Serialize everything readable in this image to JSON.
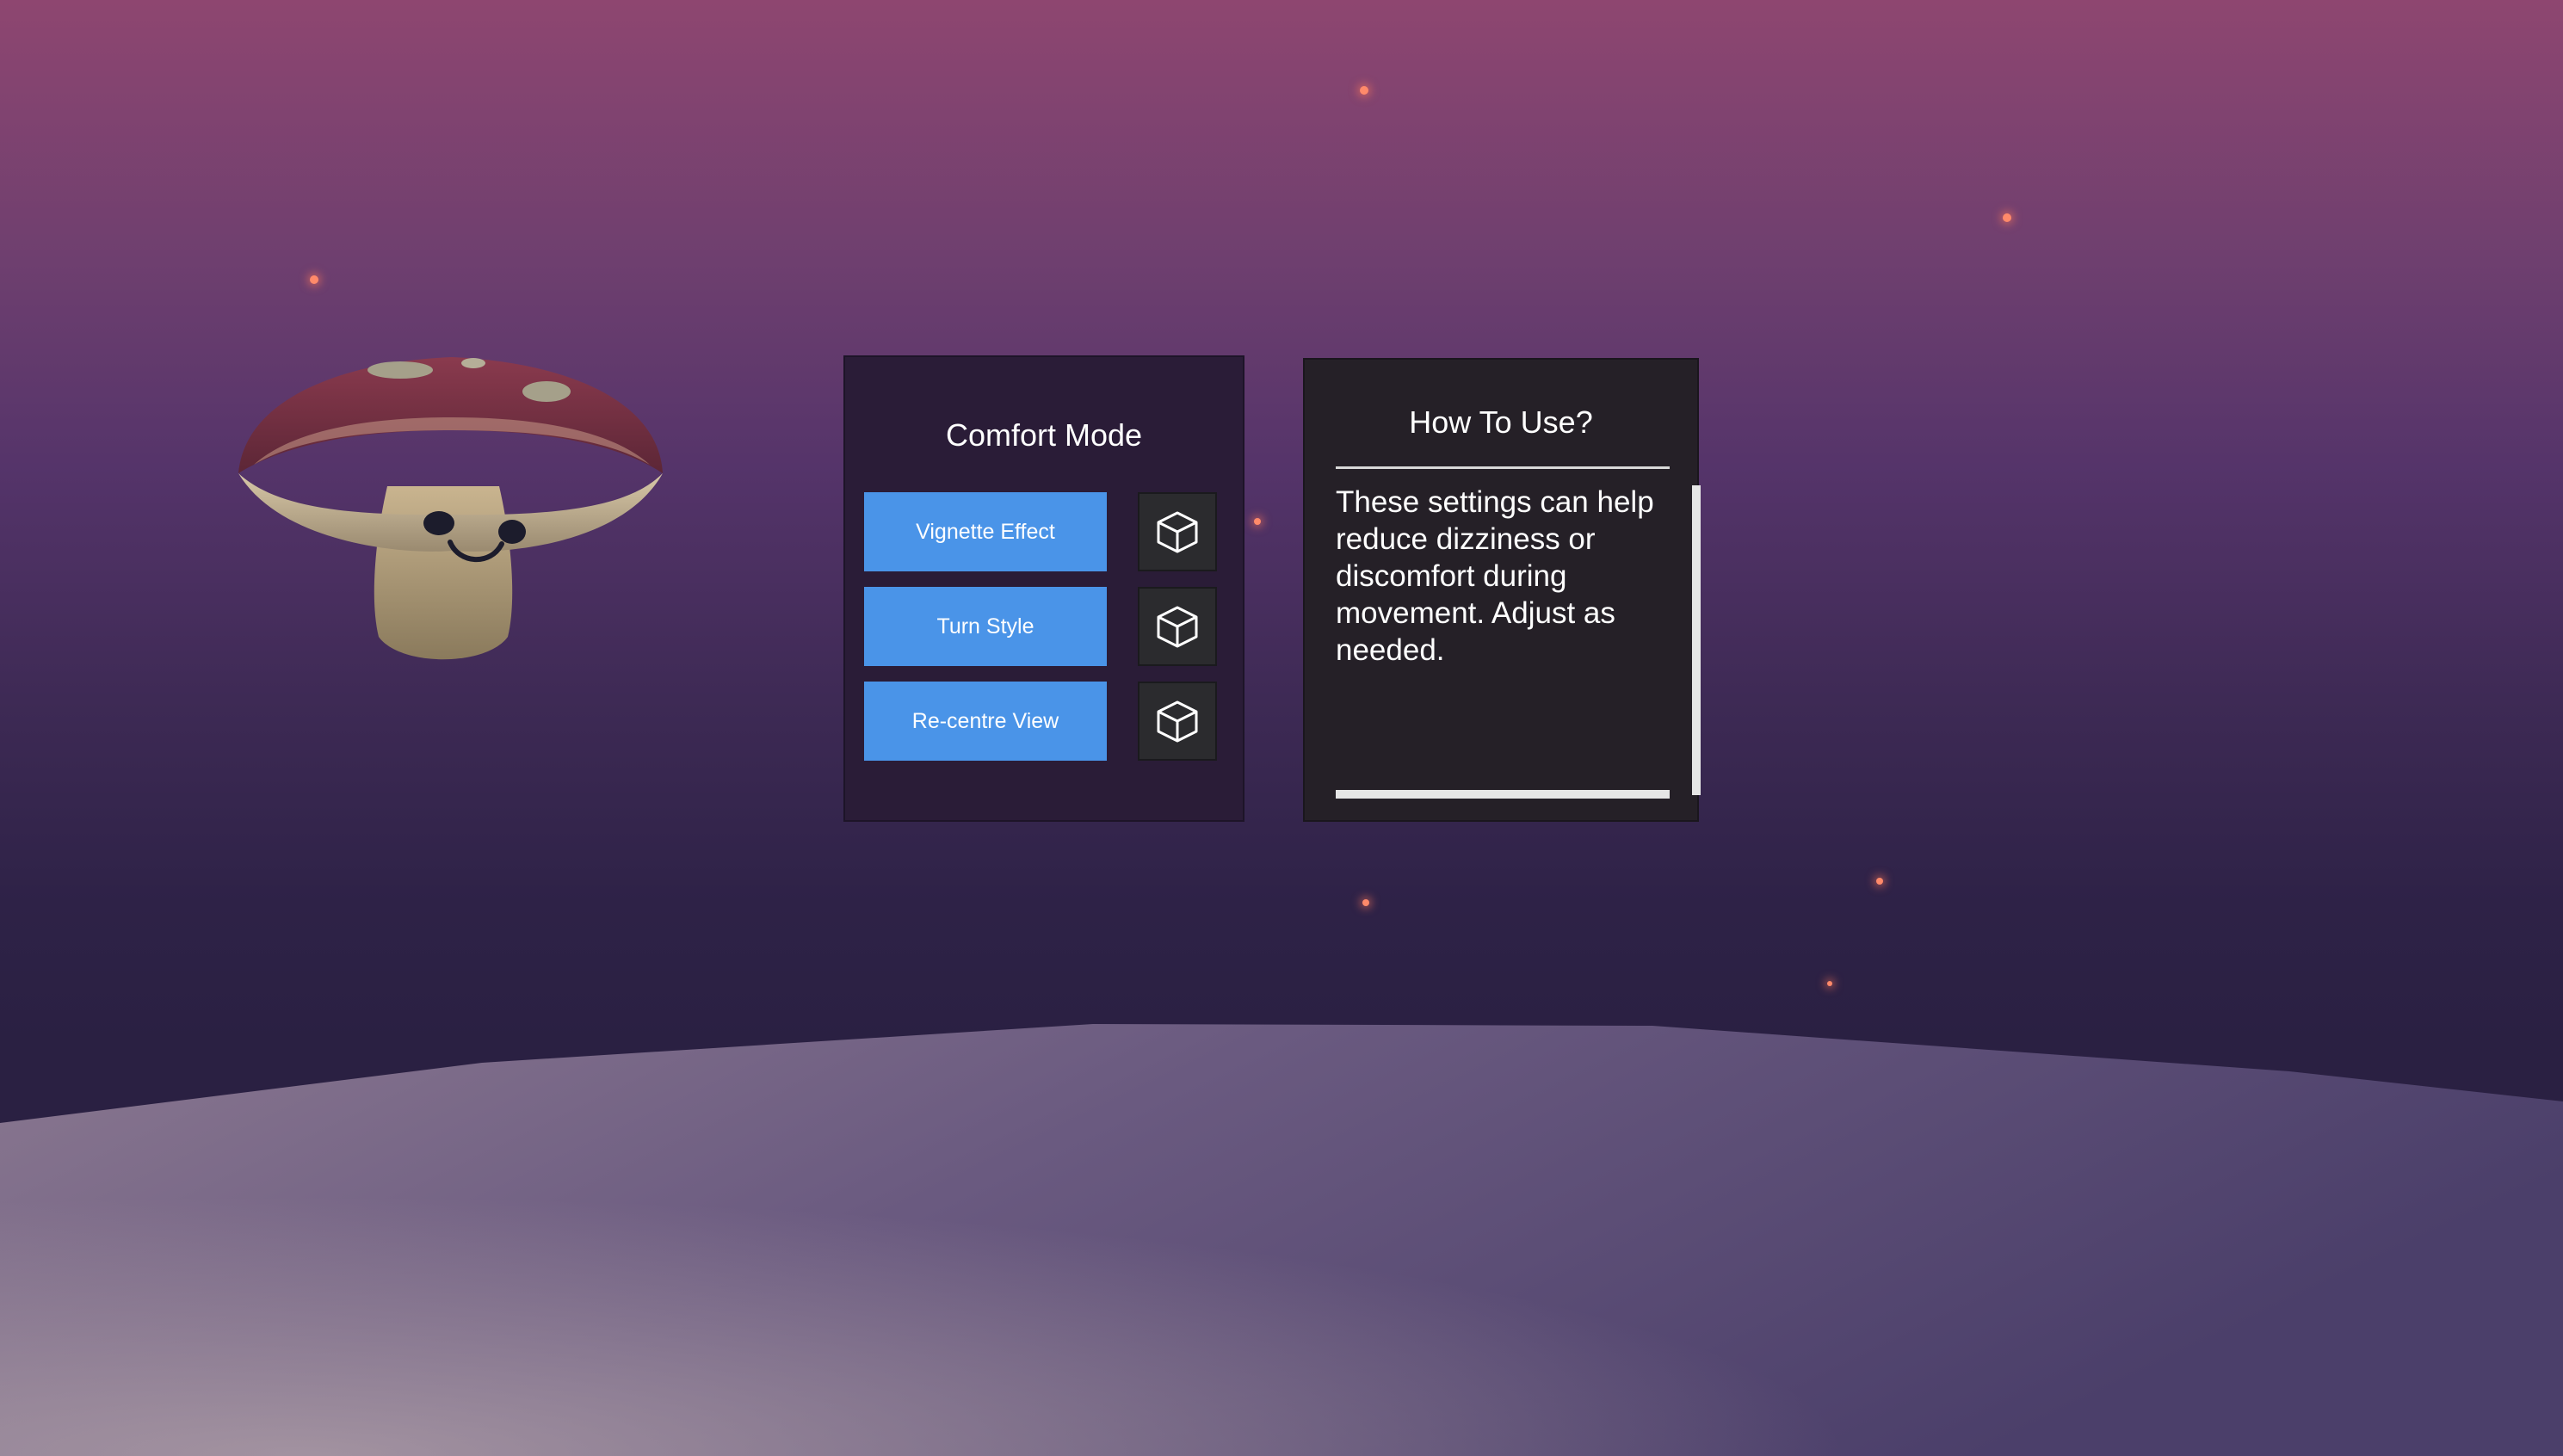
{
  "comfort_panel": {
    "title": "Comfort Mode",
    "options": [
      {
        "label": "Vignette Effect",
        "icon": "cube-icon"
      },
      {
        "label": "Turn Style",
        "icon": "cube-icon"
      },
      {
        "label": "Re-centre View",
        "icon": "cube-icon"
      }
    ],
    "colors": {
      "panel_bg": "#2a1c37",
      "button_bg": "#4a94e8",
      "icon_button_bg": "#2b2b2e"
    }
  },
  "howto_panel": {
    "title": "How To Use?",
    "body": "These settings can help reduce dizziness or discomfort during movement. Adjust as needed.",
    "vertical_scroll_fraction": 1.0,
    "horizontal_scroll_fraction": 1.0,
    "colors": {
      "panel_bg": "#252027",
      "scrollbar": "#e6e6e6"
    }
  },
  "scene": {
    "character": "mushroom-character",
    "sky_top": "#8e4670",
    "sky_bottom": "#2a2042",
    "ground_color": "#5a4c7a",
    "sparkle_color": "#ff8a6a"
  }
}
